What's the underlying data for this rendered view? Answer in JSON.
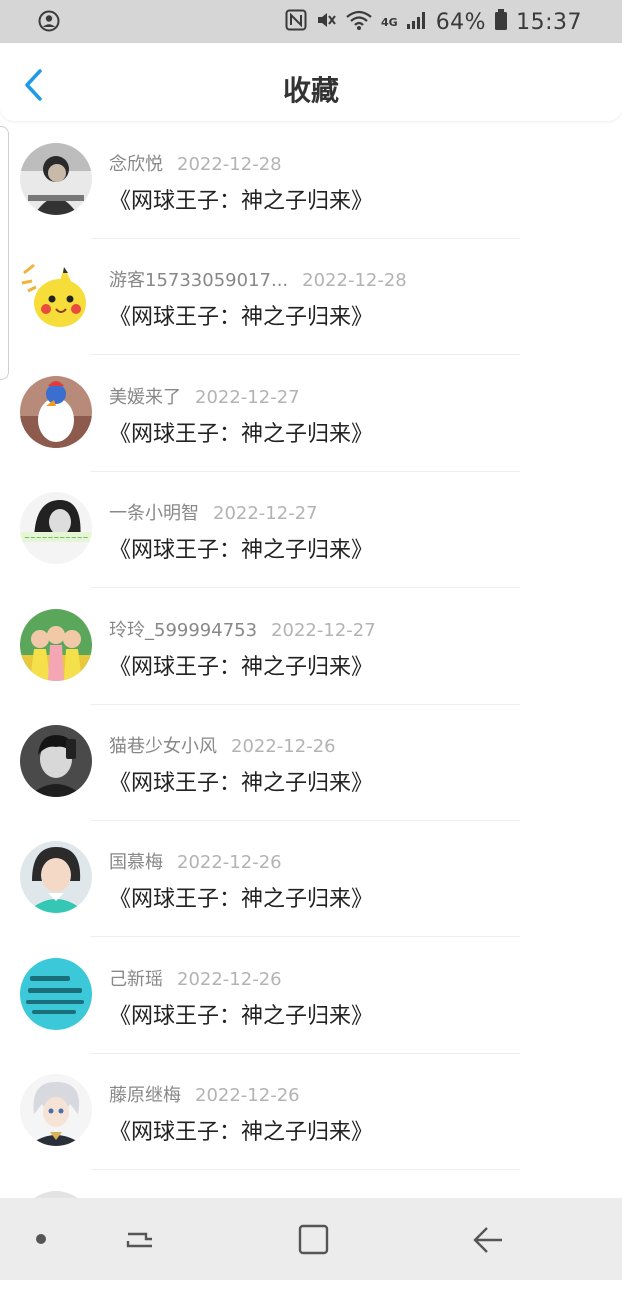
{
  "status_bar": {
    "battery_percent": "64%",
    "time": "15:37",
    "network_label": "4G",
    "icons": [
      "account-circle-icon",
      "nfc-icon",
      "mute-icon",
      "wifi-icon",
      "signal-icon",
      "battery-icon"
    ]
  },
  "header": {
    "title": "收藏",
    "back_icon": "chevron-left-icon",
    "accent_color": "#1e9be6"
  },
  "favorites": [
    {
      "user": "念欣悦",
      "date": "2022-12-28",
      "title": "《网球王子：神之子归来》"
    },
    {
      "user": "游客15733059017...",
      "date": "2022-12-28",
      "title": "《网球王子：神之子归来》"
    },
    {
      "user": "美媛来了",
      "date": "2022-12-27",
      "title": "《网球王子：神之子归来》"
    },
    {
      "user": "一条小明智",
      "date": "2022-12-27",
      "title": "《网球王子：神之子归来》"
    },
    {
      "user": "玲玲_599994753",
      "date": "2022-12-27",
      "title": "《网球王子：神之子归来》"
    },
    {
      "user": "猫巷少女小风",
      "date": "2022-12-26",
      "title": "《网球王子：神之子归来》"
    },
    {
      "user": "国慕梅",
      "date": "2022-12-26",
      "title": "《网球王子：神之子归来》"
    },
    {
      "user": "己新瑶",
      "date": "2022-12-26",
      "title": "《网球王子：神之子归来》"
    },
    {
      "user": "藤原继梅",
      "date": "2022-12-26",
      "title": "《网球王子：神之子归来》"
    }
  ],
  "nav_bar": {
    "icons": [
      "dot-icon",
      "recent-apps-icon",
      "home-icon",
      "back-icon"
    ]
  }
}
